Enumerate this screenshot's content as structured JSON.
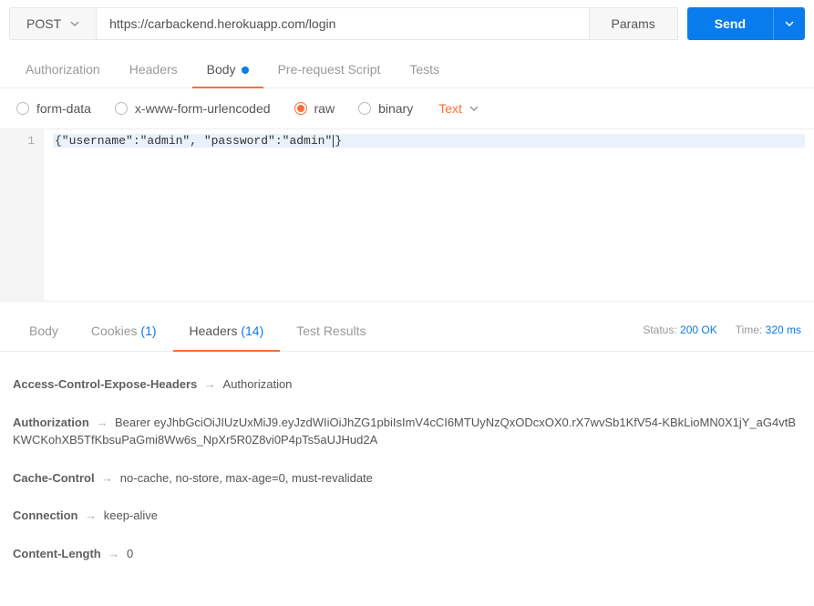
{
  "request": {
    "method": "POST",
    "url": "https://carbackend.herokuapp.com/login",
    "params_label": "Params",
    "send_label": "Send"
  },
  "req_tabs": {
    "authorization": "Authorization",
    "headers": "Headers",
    "body": "Body",
    "prerequest": "Pre-request Script",
    "tests": "Tests"
  },
  "body_types": {
    "formdata": "form-data",
    "urlencoded": "x-www-form-urlencoded",
    "raw": "raw",
    "binary": "binary",
    "text_dropdown": "Text"
  },
  "code": {
    "line1_num": "1",
    "line1": "{\"username\":\"admin\", \"password\":\"admin\"}"
  },
  "resp_tabs": {
    "body": "Body",
    "cookies": "Cookies",
    "cookies_count": "(1)",
    "headers": "Headers",
    "headers_count": "(14)",
    "test_results": "Test Results"
  },
  "response": {
    "status_label": "Status:",
    "status_value": "200 OK",
    "time_label": "Time:",
    "time_value": "320 ms"
  },
  "headers": [
    {
      "name": "Access-Control-Expose-Headers",
      "value": "Authorization"
    },
    {
      "name": "Authorization",
      "value": "Bearer eyJhbGciOiJIUzUxMiJ9.eyJzdWIiOiJhZG1pbiIsImV4cCI6MTUyNzQxODcxOX0.rX7wvSb1KfV54-KBkLioMN0X1jY_aG4vtBKWCKohXB5TfKbsuPaGmi8Ww6s_NpXr5R0Z8vi0P4pTs5aUJHud2A"
    },
    {
      "name": "Cache-Control",
      "value": "no-cache, no-store, max-age=0, must-revalidate"
    },
    {
      "name": "Connection",
      "value": "keep-alive"
    },
    {
      "name": "Content-Length",
      "value": "0"
    }
  ]
}
